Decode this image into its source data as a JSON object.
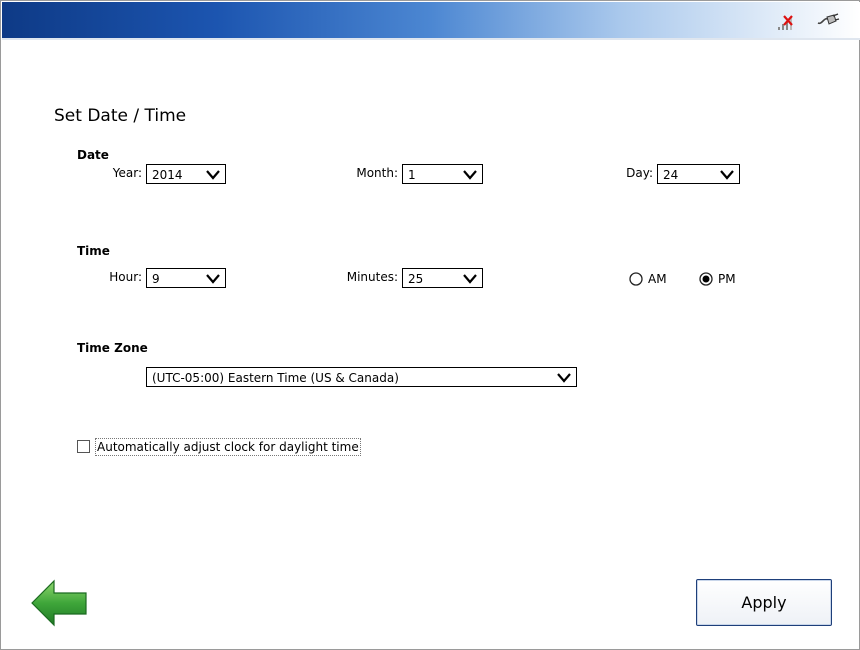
{
  "icons": {
    "signal": "no-signal-icon",
    "plug": "power-plug-icon",
    "back": "back-arrow-icon"
  },
  "colors": {
    "header_dark": "#0e3a86",
    "back_arrow": "#3fa63a",
    "apply_border": "#1e3f7a"
  },
  "page": {
    "title": "Set Date / Time"
  },
  "date": {
    "section_label": "Date",
    "year": {
      "label": "Year:",
      "value": "2014"
    },
    "month": {
      "label": "Month:",
      "value": "1"
    },
    "day": {
      "label": "Day:",
      "value": "24"
    }
  },
  "time": {
    "section_label": "Time",
    "hour": {
      "label": "Hour:",
      "value": "9"
    },
    "minutes": {
      "label": "Minutes:",
      "value": "25"
    },
    "am": {
      "label": "AM",
      "selected": false
    },
    "pm": {
      "label": "PM",
      "selected": true
    }
  },
  "timezone": {
    "section_label": "Time Zone",
    "value": "(UTC-05:00) Eastern Time (US & Canada)"
  },
  "daylight": {
    "label": "Automatically adjust clock for daylight time",
    "checked": false
  },
  "buttons": {
    "apply": "Apply"
  }
}
